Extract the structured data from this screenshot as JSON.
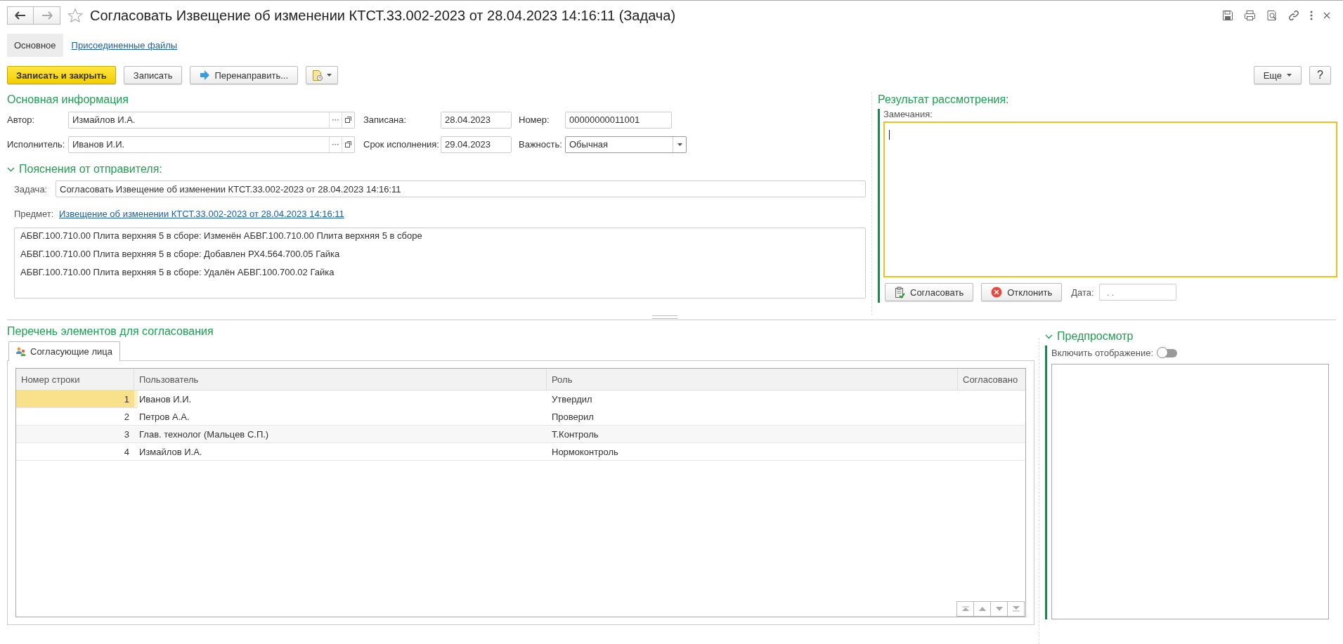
{
  "window": {
    "title": "Согласовать Извещение об изменении КТСТ.33.002-2023 от 28.04.2023 14:16:11 (Задача)",
    "favorite": false
  },
  "tabs": [
    {
      "label": "Основное",
      "selected": true
    },
    {
      "label": "Присоединенные файлы",
      "selected": false
    }
  ],
  "toolbar": {
    "buttons": [
      {
        "kind": "primary",
        "label": "Записать и закрыть"
      },
      {
        "kind": "plain",
        "label": "Записать"
      },
      {
        "kind": "forward",
        "label": "Перенаправить..."
      },
      {
        "kind": "menu"
      }
    ],
    "right_buttons": [
      {
        "kind": "dropdown",
        "label": "Еще"
      },
      {
        "kind": "plain",
        "label": "?"
      }
    ]
  },
  "main_info": {
    "title": "Основная информация",
    "rows": [
      [
        {
          "kind": "ref",
          "label": "Автор:",
          "value": "Измайлов И.А."
        },
        {
          "kind": "date",
          "label": "Записана:",
          "value": "28.04.2023"
        },
        {
          "kind": "text",
          "label": "Номер:",
          "value": "00000000011001"
        }
      ],
      [
        {
          "kind": "ref",
          "label": "Исполнитель:",
          "value": "Иванов И.И."
        },
        {
          "kind": "date",
          "label": "Срок исполнения:",
          "value": "29.04.2023"
        },
        {
          "kind": "select",
          "label": "Важность:",
          "value": "Обычная"
        }
      ]
    ]
  },
  "sender_notes": {
    "title": "Пояснения от отправителя:",
    "expanded": true,
    "task_label": "Задача:",
    "task_value": "Согласовать Извещение об изменении КТСТ.33.002-2023 от 28.04.2023 14:16:11",
    "subject_label": "Предмет:",
    "subject_link": "Извещение об изменении КТСТ.33.002-2023 от 28.04.2023 14:16:11",
    "lines": [
      "АБВГ.100.710.00 Плита верхняя 5 в сборе: Изменён АБВГ.100.710.00 Плита верхняя 5 в сборе",
      "АБВГ.100.710.00 Плита верхняя 5 в сборе: Добавлен РХ4.564.700.05 Гайка",
      "АБВГ.100.710.00 Плита верхняя 5 в сборе: Удалён АБВГ.100.700.02 Гайка"
    ]
  },
  "review": {
    "title": "Результат рассмотрения:",
    "remarks_label": "Замечания:",
    "remarks_focused": true,
    "approve_button": "Согласовать",
    "reject_button": "Отклонить",
    "date_label": "Дата:",
    "date_value": ". ."
  },
  "approval_list": {
    "title": "Перечень элементов для согласования",
    "tabs": [
      {
        "label": "Согласующие лица",
        "selected": true
      }
    ],
    "columns": [
      "Номер строки",
      "Пользователь",
      "Роль",
      "Согласовано"
    ],
    "rows": [
      {
        "number": "1",
        "user": "Иванов И.И.",
        "role": "Утвердил",
        "selected": true
      },
      {
        "number": "2",
        "user": "Петров А.А.",
        "role": "Проверил",
        "selected": false
      },
      {
        "number": "3",
        "user": "Глав. технолог (Мальцев С.П.)",
        "role": "Т.Контроль",
        "selected": false
      },
      {
        "number": "4",
        "user": "Измайлов И.А.",
        "role": "Нормоконтроль",
        "selected": false
      }
    ]
  },
  "preview": {
    "title": "Предпросмотр",
    "expanded": true,
    "toggle_label": "Включить отображение:",
    "on": false
  }
}
